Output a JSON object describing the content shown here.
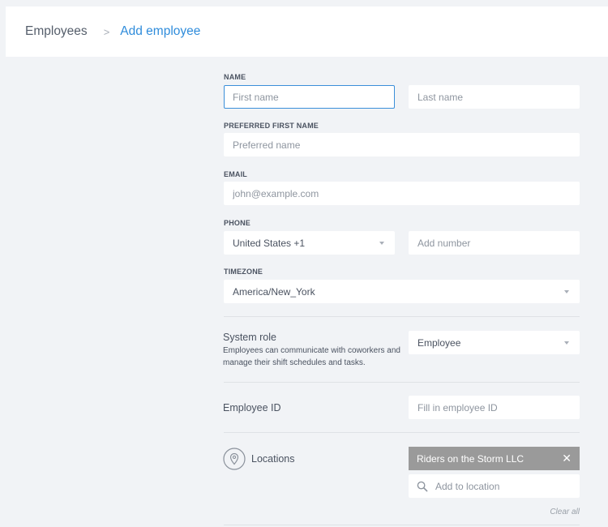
{
  "breadcrumb": {
    "root": "Employees",
    "separator": ">",
    "current": "Add employee"
  },
  "name": {
    "label": "NAME",
    "first_placeholder": "First name",
    "last_placeholder": "Last name"
  },
  "preferred": {
    "label": "PREFERRED FIRST NAME",
    "placeholder": "Preferred name"
  },
  "email": {
    "label": "EMAIL",
    "placeholder": "john@example.com"
  },
  "phone": {
    "label": "PHONE",
    "country": "United States +1",
    "number_placeholder": "Add number"
  },
  "timezone": {
    "label": "TIMEZONE",
    "value": "America/New_York"
  },
  "system_role": {
    "title": "System role",
    "description": "Employees can communicate with coworkers and manage their shift schedules and tasks.",
    "value": "Employee"
  },
  "employee_id": {
    "title": "Employee ID",
    "placeholder": "Fill in employee ID"
  },
  "locations": {
    "title": "Locations",
    "selected": [
      "Riders on the Storm LLC"
    ],
    "add_placeholder": "Add to location",
    "clear_all": "Clear all",
    "icons": {
      "location": "location-pin-icon",
      "search": "search-icon",
      "remove": "close-icon"
    }
  },
  "colors": {
    "accent": "#2f8cdb",
    "background": "#f1f3f6",
    "tag": "#9a9a9a"
  }
}
